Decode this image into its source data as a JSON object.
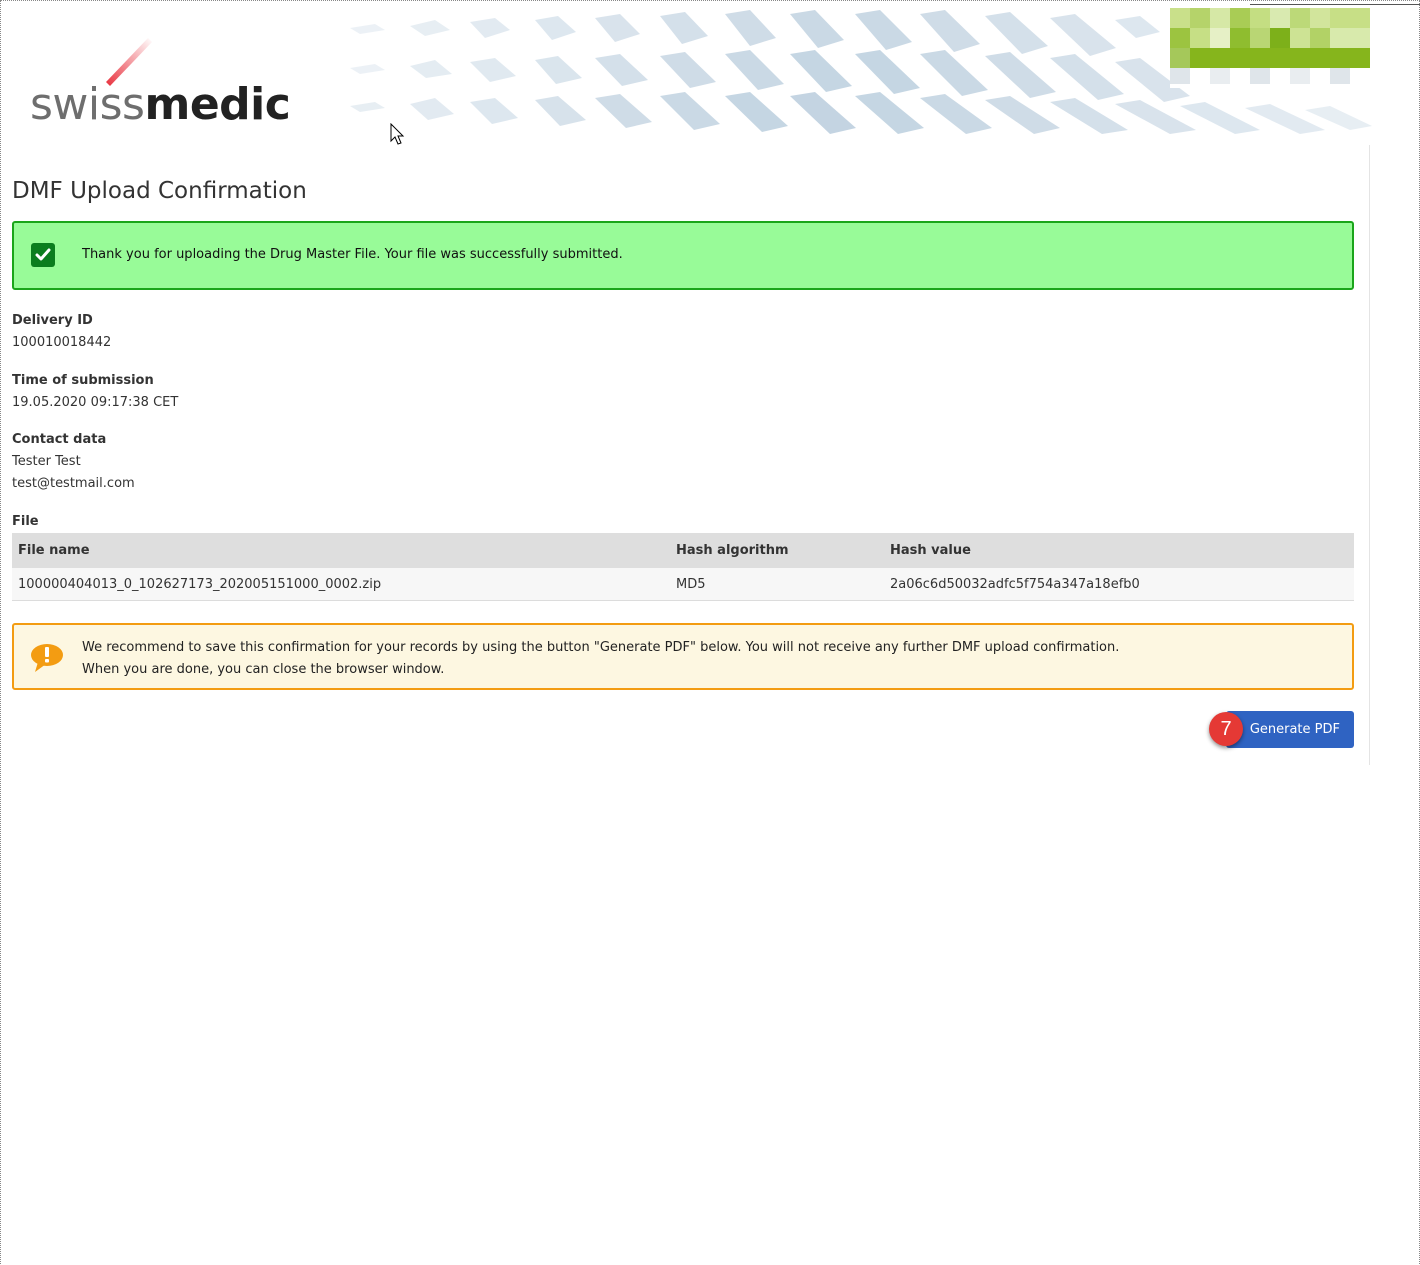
{
  "logo": {
    "light": "swiss",
    "dark": "medic"
  },
  "page_title": "DMF Upload Confirmation",
  "success": {
    "message": "Thank you for uploading the Drug Master File. Your file was successfully submitted."
  },
  "delivery": {
    "label": "Delivery ID",
    "value": "100010018442"
  },
  "submission": {
    "label": "Time of submission",
    "value": "19.05.2020 09:17:38 CET"
  },
  "contact": {
    "label": "Contact data",
    "name": "Tester Test",
    "email": "test@testmail.com"
  },
  "file": {
    "label": "File",
    "columns": [
      "File name",
      "Hash algorithm",
      "Hash value"
    ],
    "rows": [
      [
        "100000404013_0_102627173_202005151000_0002.zip",
        "MD5",
        "2a06c6d50032adfc5f754a347a18efb0"
      ]
    ]
  },
  "warning": {
    "line1": "We recommend to save this confirmation for your records by using the button \"Generate PDF\" below. You will not receive any further DMF upload confirmation.",
    "line2": "When you are done, you can close the browser window."
  },
  "generate_button": {
    "label": "Generate PDF",
    "step_badge": "7"
  },
  "colors": {
    "success_bg": "#98fb98",
    "success_border": "#1aa51a",
    "warning_bg": "#fdf7e1",
    "warning_border": "#f39c12",
    "button": "#2f63c2",
    "badge": "#e53935"
  },
  "icons": {
    "success": "check-icon",
    "warning": "exclamation-speech-icon",
    "cursor": "mouse-pointer-icon"
  }
}
